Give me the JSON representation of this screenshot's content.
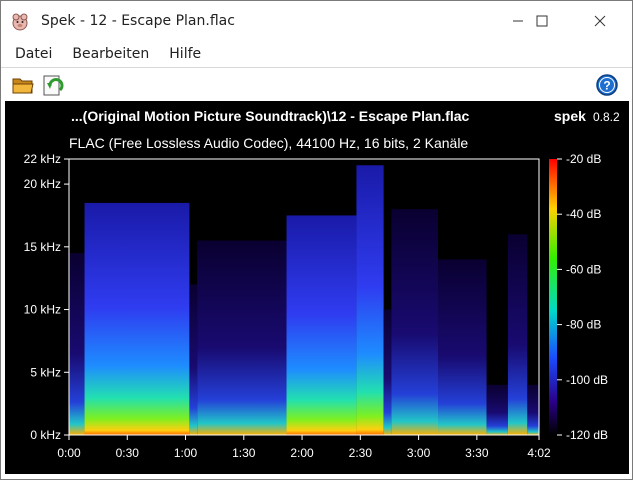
{
  "window": {
    "title": "Spek - 12 - Escape Plan.flac"
  },
  "menu": {
    "items": [
      "Datei",
      "Bearbeiten",
      "Hilfe"
    ]
  },
  "toolbar": {
    "icons": [
      "open-folder-icon",
      "reload-icon",
      "help-icon"
    ]
  },
  "spectrogram": {
    "file_title": "...(Original Motion Picture Soundtrack)\\12 - Escape Plan.flac",
    "app_name": "spek",
    "app_version": "0.8.2",
    "codec_info": "FLAC (Free Lossless Audio Codec), 44100 Hz, 16 bits, 2 Kanäle",
    "duration_seconds": 242,
    "frequency_axis": {
      "max_khz": 22,
      "labels": [
        "22 kHz",
        "20 kHz",
        "15 kHz",
        "10 kHz",
        "5 kHz",
        "0 kHz"
      ],
      "values_khz": [
        22,
        20,
        15,
        10,
        5,
        0
      ]
    },
    "time_axis": {
      "labels": [
        "0:00",
        "0:30",
        "1:00",
        "1:30",
        "2:00",
        "2:30",
        "3:00",
        "3:30",
        "4:02"
      ],
      "values_sec": [
        0,
        30,
        60,
        90,
        120,
        150,
        180,
        210,
        242
      ]
    },
    "db_scale": {
      "labels": [
        "-20 dB",
        "-40 dB",
        "-60 dB",
        "-80 dB",
        "-100 dB",
        "-120 dB"
      ],
      "values_db": [
        -20,
        -40,
        -60,
        -80,
        -100,
        -120
      ],
      "colors": [
        "#ff0000",
        "#ffd000",
        "#33ee00",
        "#00d8c8",
        "#1a4cff",
        "#2a0088",
        "#000000"
      ]
    }
  }
}
